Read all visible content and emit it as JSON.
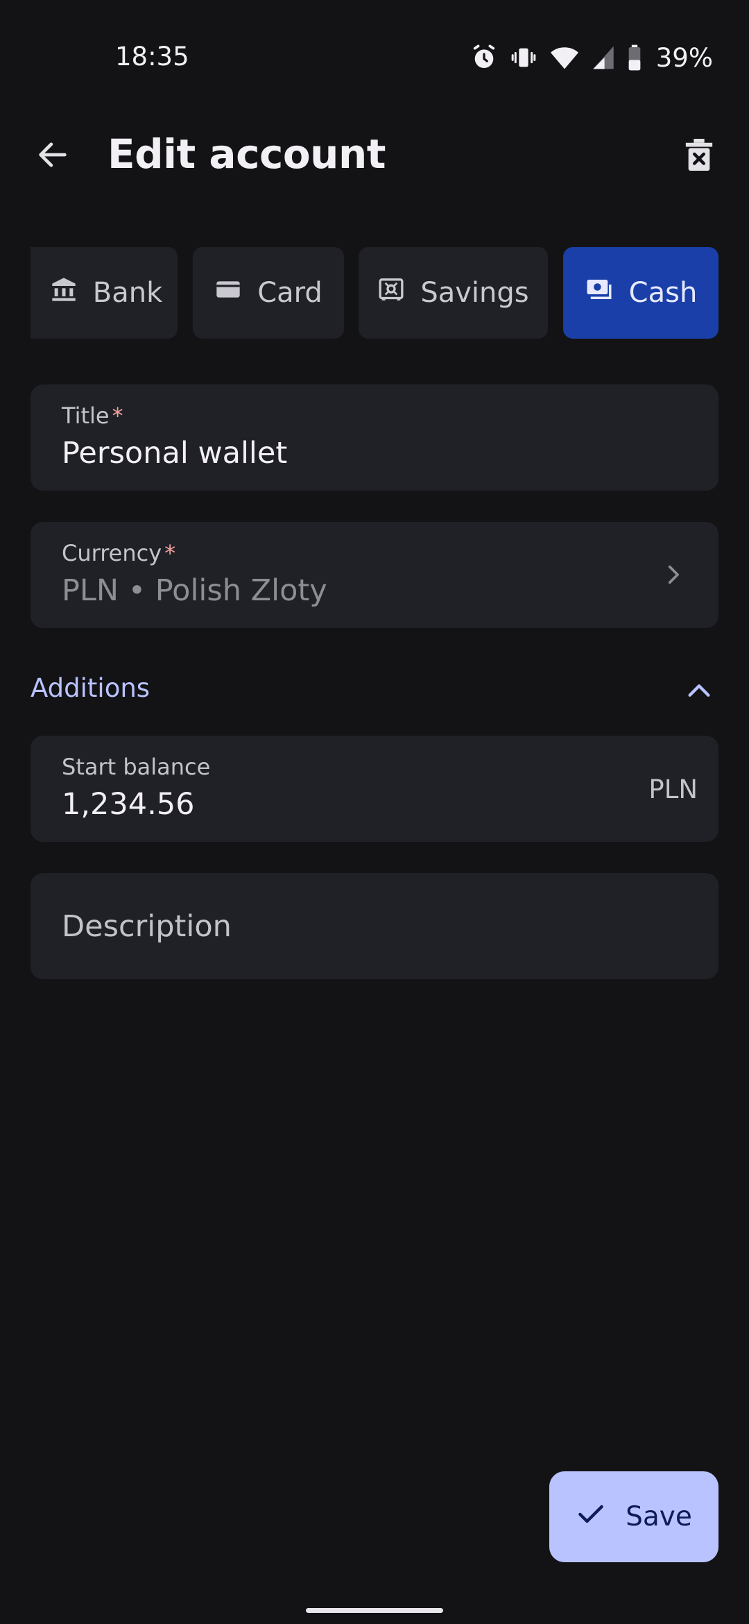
{
  "status_bar": {
    "time": "18:35",
    "battery_percent": "39%",
    "icons": [
      "alarm-icon",
      "vibrate-icon",
      "wifi-icon",
      "signal-icon",
      "battery-icon"
    ]
  },
  "header": {
    "title": "Edit account",
    "back_icon": "arrow-back-icon",
    "delete_icon": "delete-icon"
  },
  "account_types": [
    {
      "label": "Bank",
      "icon": "bank-icon",
      "selected": false
    },
    {
      "label": "Card",
      "icon": "card-icon",
      "selected": false
    },
    {
      "label": "Savings",
      "icon": "safe-icon",
      "selected": false
    },
    {
      "label": "Cash",
      "icon": "cash-icon",
      "selected": true
    }
  ],
  "form": {
    "title_label": "Title",
    "title_value": "Personal wallet",
    "currency_label": "Currency",
    "currency_value": "PLN • Polish Zloty",
    "required_mark": "*"
  },
  "additions": {
    "label": "Additions",
    "expanded": true,
    "start_balance_label": "Start balance",
    "start_balance_value": "1,234.56",
    "start_balance_currency": "PLN",
    "description_placeholder": "Description"
  },
  "actions": {
    "save_label": "Save"
  },
  "colors": {
    "background": "#131316",
    "surface": "#202127",
    "selected_chip": "#1a3fa8",
    "accent": "#b9c3ff",
    "required": "#f2a19c"
  }
}
